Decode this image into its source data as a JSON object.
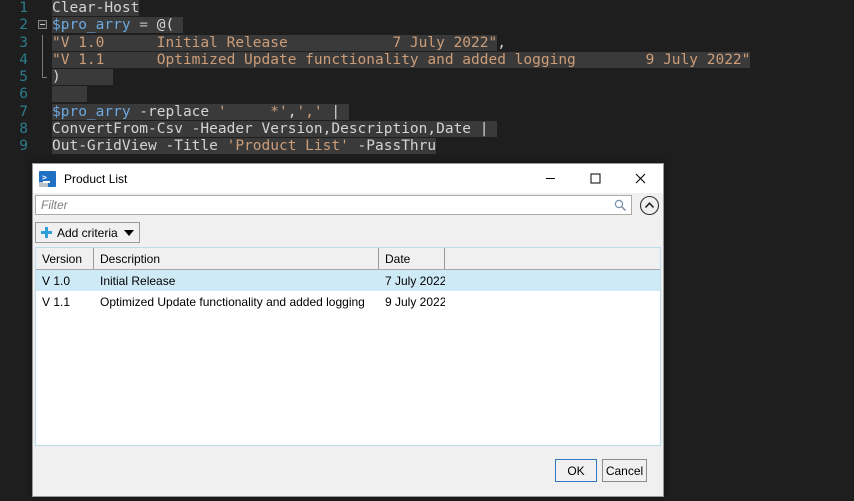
{
  "editor": {
    "lines": [
      {
        "num": "1",
        "segments": [
          {
            "text": "Clear-Host",
            "cls": "tok-cmd",
            "sel": true
          }
        ]
      },
      {
        "num": "2",
        "fold": "start",
        "segments": [
          {
            "text": "$pro_arry",
            "cls": "tok-var",
            "sel": true
          },
          {
            "text": " = ",
            "cls": "tok-op",
            "sel": true
          },
          {
            "text": "@(",
            "cls": "tok-plain",
            "sel": true
          },
          {
            "text": " ",
            "cls": "tok-plain",
            "sel": true
          }
        ]
      },
      {
        "num": "3",
        "fold": "mid",
        "segments": [
          {
            "text": "\"V 1.0      Initial Release            7 July 2022\"",
            "cls": "tok-str",
            "sel": true
          },
          {
            "text": ",",
            "cls": "tok-plain",
            "sel": false
          }
        ]
      },
      {
        "num": "4",
        "fold": "mid",
        "segments": [
          {
            "text": "\"V 1.1      Optimized Update functionality and added logging        9 July 2022\"",
            "cls": "tok-str",
            "sel": true
          }
        ]
      },
      {
        "num": "5",
        "fold": "end",
        "segments": [
          {
            "text": ")",
            "cls": "tok-plain",
            "sel": true
          },
          {
            "text": "      ",
            "cls": "tok-plain",
            "sel": true
          }
        ]
      },
      {
        "num": "6",
        "segments": [
          {
            "text": "    ",
            "cls": "tok-plain",
            "sel": true
          }
        ]
      },
      {
        "num": "7",
        "segments": [
          {
            "text": "$pro_arry",
            "cls": "tok-var",
            "sel": true
          },
          {
            "text": " -replace ",
            "cls": "tok-plain",
            "sel": true
          },
          {
            "text": "'     *'",
            "cls": "tok-str",
            "sel": true
          },
          {
            "text": ",",
            "cls": "tok-plain",
            "sel": true
          },
          {
            "text": "','",
            "cls": "tok-str",
            "sel": true
          },
          {
            "text": " |",
            "cls": "tok-plain",
            "sel": true
          },
          {
            "text": " ",
            "cls": "tok-plain",
            "sel": true
          }
        ]
      },
      {
        "num": "8",
        "segments": [
          {
            "text": "ConvertFrom-Csv",
            "cls": "tok-cmd",
            "sel": true
          },
          {
            "text": " -Header Version,Description,Date |",
            "cls": "tok-plain",
            "sel": true
          },
          {
            "text": " ",
            "cls": "tok-plain",
            "sel": true
          }
        ]
      },
      {
        "num": "9",
        "segments": [
          {
            "text": "Out-GridView",
            "cls": "tok-cmd",
            "sel": true
          },
          {
            "text": " -Title ",
            "cls": "tok-plain",
            "sel": true
          },
          {
            "text": "'Product List'",
            "cls": "tok-str",
            "sel": true
          },
          {
            "text": " -PassThru",
            "cls": "tok-plain",
            "sel": true
          }
        ]
      }
    ]
  },
  "dialog": {
    "title": "Product List",
    "icon": "powershell-icon",
    "window_buttons": {
      "minimize": "–",
      "maximize": "☐",
      "close": "✕"
    },
    "filter": {
      "value": "",
      "placeholder": "Filter",
      "search_icon": "magnifier-icon",
      "collapse_icon": "chevron-up-circle-icon"
    },
    "add_criteria": {
      "label": "Add criteria",
      "plus_icon": "plus-icon",
      "caret_icon": "caret-down-icon"
    },
    "grid": {
      "columns": [
        "Version",
        "Description",
        "Date",
        ""
      ],
      "rows": [
        {
          "selected": true,
          "cells": [
            "V 1.0",
            "Initial Release",
            "7 July 2022",
            ""
          ]
        },
        {
          "selected": false,
          "cells": [
            "V 1.1",
            "Optimized Update functionality and added logging",
            "9 July 2022",
            ""
          ]
        }
      ]
    },
    "buttons": {
      "ok": "OK",
      "cancel": "Cancel"
    }
  },
  "colors": {
    "editor_bg": "#1e1e1e",
    "editor_selection": "#3a3a3a",
    "line_number": "#2b7c8c",
    "string": "#cd9d78",
    "variable": "#6ba9e0",
    "plain": "#d4d4d4",
    "row_selected": "#cfeaf7",
    "accent_blue": "#2f78c4",
    "plus_blue": "#2f9fd8"
  }
}
